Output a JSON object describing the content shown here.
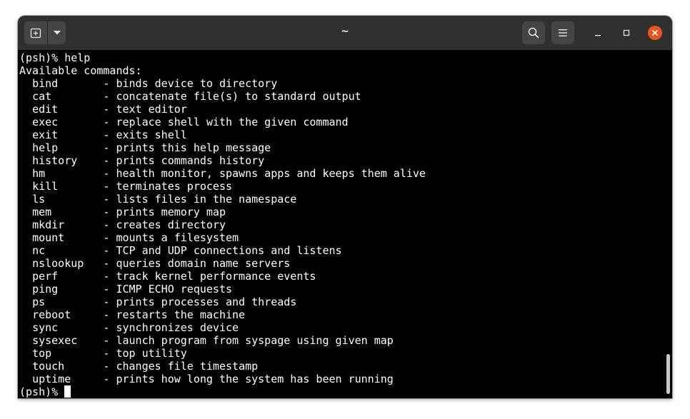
{
  "window": {
    "title": "~",
    "accent_close_color": "#e95420",
    "titlebar_color": "#303030"
  },
  "toolbar": {
    "new_tab_icon": "new-tab-icon",
    "new_tab_menu_icon": "chevron-down-icon",
    "search_icon": "search-icon",
    "menu_icon": "hamburger-menu-icon"
  },
  "window_controls": {
    "minimize_icon": "minimize-icon",
    "maximize_icon": "maximize-icon",
    "close_icon": "close-icon"
  },
  "terminal": {
    "prompt": "(psh)% ",
    "command": "help",
    "header": "Available commands:",
    "commands": [
      {
        "name": "bind",
        "desc": "binds device to directory"
      },
      {
        "name": "cat",
        "desc": "concatenate file(s) to standard output"
      },
      {
        "name": "edit",
        "desc": "text editor"
      },
      {
        "name": "exec",
        "desc": "replace shell with the given command"
      },
      {
        "name": "exit",
        "desc": "exits shell"
      },
      {
        "name": "help",
        "desc": "prints this help message"
      },
      {
        "name": "history",
        "desc": "prints commands history"
      },
      {
        "name": "hm",
        "desc": "health monitor, spawns apps and keeps them alive"
      },
      {
        "name": "kill",
        "desc": "terminates process"
      },
      {
        "name": "ls",
        "desc": "lists files in the namespace"
      },
      {
        "name": "mem",
        "desc": "prints memory map"
      },
      {
        "name": "mkdir",
        "desc": "creates directory"
      },
      {
        "name": "mount",
        "desc": "mounts a filesystem"
      },
      {
        "name": "nc",
        "desc": "TCP and UDP connections and listens"
      },
      {
        "name": "nslookup",
        "desc": "queries domain name servers"
      },
      {
        "name": "perf",
        "desc": "track kernel performance events"
      },
      {
        "name": "ping",
        "desc": "ICMP ECHO requests"
      },
      {
        "name": "ps",
        "desc": "prints processes and threads"
      },
      {
        "name": "reboot",
        "desc": "restarts the machine"
      },
      {
        "name": "sync",
        "desc": "synchronizes device"
      },
      {
        "name": "sysexec",
        "desc": "launch program from syspage using given map"
      },
      {
        "name": "top",
        "desc": "top utility"
      },
      {
        "name": "touch",
        "desc": "changes file timestamp"
      },
      {
        "name": "uptime",
        "desc": "prints how long the system has been running"
      }
    ],
    "final_prompt": "(psh)% "
  }
}
